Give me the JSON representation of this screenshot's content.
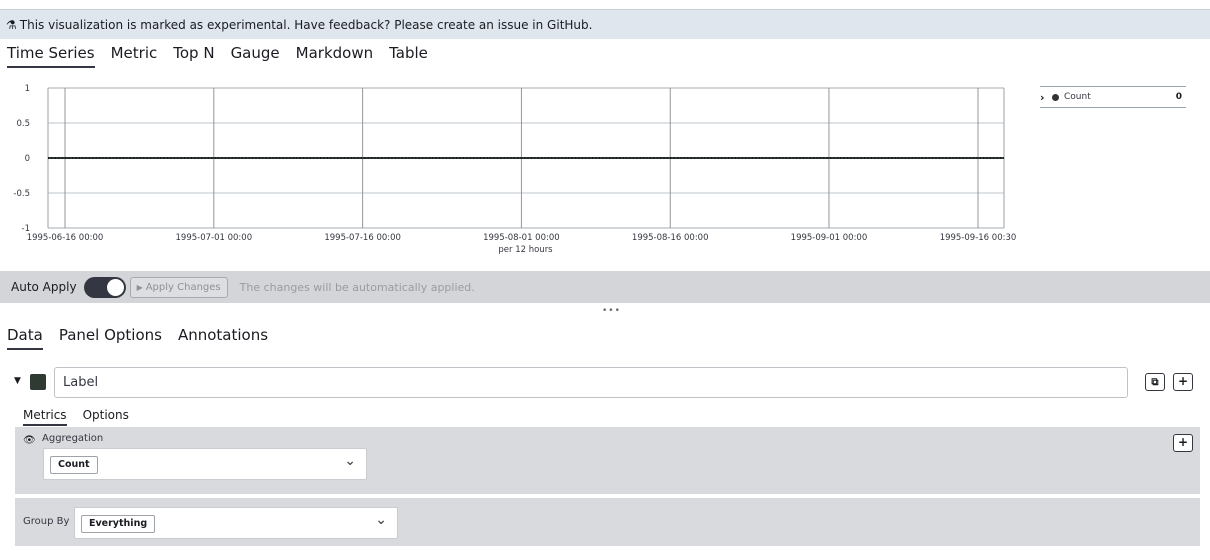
{
  "banner": {
    "icon": "flask-icon",
    "text": "This visualization is marked as experimental. Have feedback? Please create an issue in GitHub."
  },
  "vis_tabs": [
    "Time Series",
    "Metric",
    "Top N",
    "Gauge",
    "Markdown",
    "Table"
  ],
  "vis_tabs_active": "Time Series",
  "chart_data": {
    "type": "line",
    "x_ticks": [
      "1995-06-16 00:00",
      "1995-07-01 00:00",
      "1995-07-16 00:00",
      "1995-08-01 00:00",
      "1995-08-16 00:00",
      "1995-09-01 00:00",
      "1995-09-16 00:30"
    ],
    "x_interval": "per 12 hours",
    "y_ticks": [
      "1",
      "0.5",
      "0",
      "-0.5",
      "-1"
    ],
    "ylim": [
      -1,
      1
    ],
    "grid": true,
    "series": [
      {
        "name": "Count",
        "color": "#2f3b32",
        "constant_value": 0
      }
    ],
    "legend_placement": "right"
  },
  "legend": {
    "items": [
      {
        "label": "Count",
        "value": "0"
      }
    ]
  },
  "apply_bar": {
    "auto_apply_label": "Auto Apply",
    "auto_apply_on": true,
    "apply_button": "Apply Changes",
    "message": "The changes will be automatically applied."
  },
  "resize_handle": "•••",
  "panel_tabs": [
    "Data",
    "Panel Options",
    "Annotations"
  ],
  "panel_tabs_active": "Data",
  "series_editor": {
    "label_value": "Label",
    "swatch_color": "#2f3b32",
    "sub_tabs": [
      "Metrics",
      "Options"
    ],
    "sub_tabs_active": "Metrics",
    "aggregation_label": "Aggregation",
    "aggregation_value": "Count",
    "group_by_label": "Group By",
    "group_by_value": "Everything"
  },
  "colors": {
    "banner_bg": "#dfe6ee",
    "apply_bar_bg": "#d3d5d8",
    "panel_bg": "#d8dadd",
    "accent": "#343741"
  }
}
